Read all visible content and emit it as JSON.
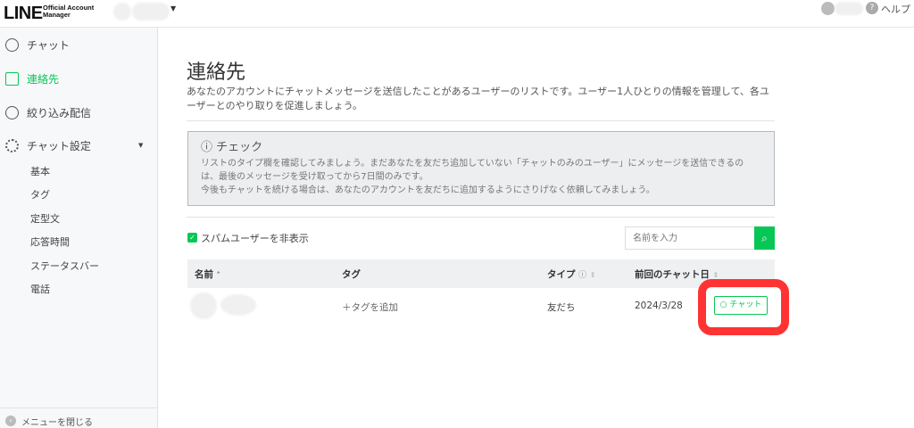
{
  "header": {
    "logo": "LINE",
    "logo_sub": "Official Account\nManager",
    "help": "ヘルプ"
  },
  "sidebar": {
    "items": [
      {
        "label": "チャット",
        "icon": "chat-bubble-icon"
      },
      {
        "label": "連絡先",
        "icon": "contact-icon",
        "active": true
      },
      {
        "label": "絞り込み配信",
        "icon": "broadcast-icon"
      },
      {
        "label": "チャット設定",
        "icon": "gear-icon"
      }
    ],
    "sub_items": [
      "基本",
      "タグ",
      "定型文",
      "応答時間",
      "ステータスバー",
      "電話"
    ],
    "close_menu": "メニューを閉じる"
  },
  "main": {
    "title": "連絡先",
    "description": "あなたのアカウントにチャットメッセージを送信したことがあるユーザーのリストです。ユーザー1人ひとりの情報を管理して、各ユーザーとのやり取りを促進しましょう。",
    "check": {
      "title": "チェック",
      "lines": [
        "リストのタイプ欄を確認してみましょう。まだあなたを友だち追加していない「チャットのみのユーザー」にメッセージを送信できるのは、最後のメッセージを受け取ってから7日間のみです。",
        "今後もチャットを続ける場合は、あなたのアカウントを友だちに追加するようにさりげなく依頼してみましょう。"
      ]
    },
    "hide_spam": {
      "label": "スパムユーザーを非表示",
      "checked": true
    },
    "search": {
      "placeholder": "名前を入力",
      "value": ""
    },
    "table": {
      "headers": [
        "名前",
        "タグ",
        "タイプ",
        "前回のチャット日"
      ],
      "rows": [
        {
          "tag": "＋タグを追加",
          "type": "友だち",
          "date": "2024/3/28",
          "action": "チャット"
        }
      ]
    }
  },
  "colors": {
    "accent": "#06c755",
    "highlight": "#ff3333"
  }
}
